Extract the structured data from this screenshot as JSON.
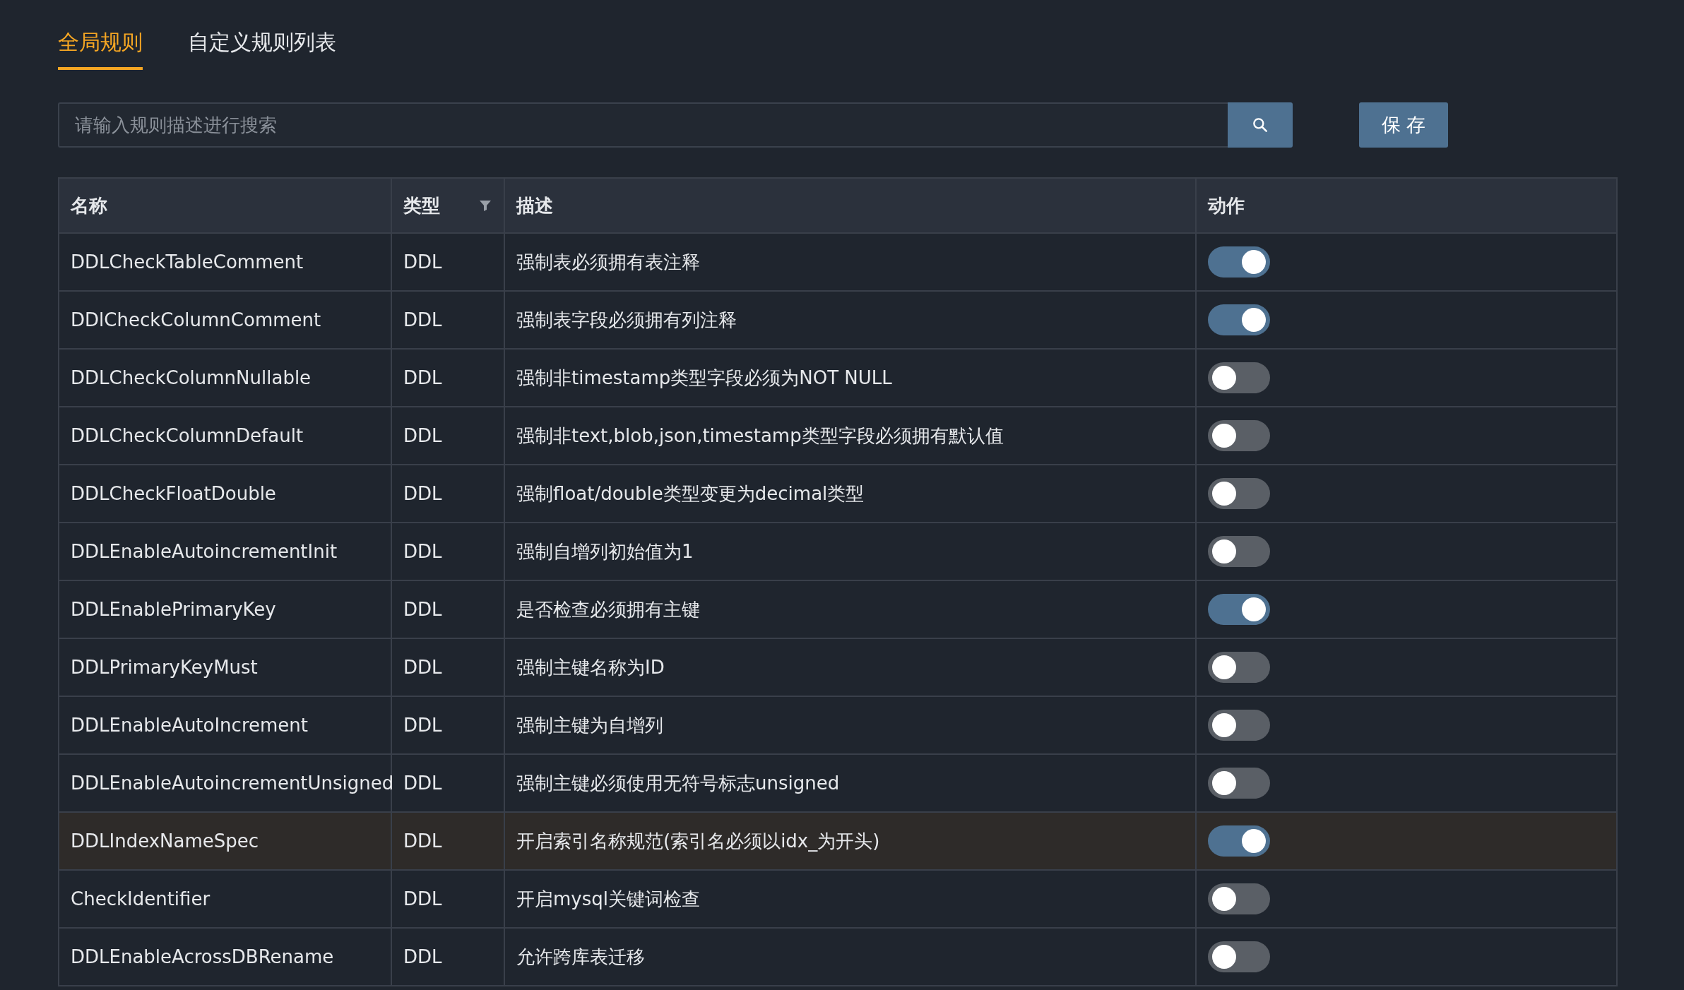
{
  "tabs": [
    {
      "label": "全局规则",
      "selected": true
    },
    {
      "label": "自定义规则列表",
      "selected": false
    }
  ],
  "search": {
    "placeholder": "请输入规则描述进行搜索"
  },
  "save_button": "保 存",
  "table": {
    "columns": [
      "名称",
      "类型",
      "描述",
      "动作"
    ],
    "rows": [
      {
        "name": "DDLCheckTableComment",
        "type": "DDL",
        "description": "强制表必须拥有表注释",
        "on": true,
        "hovered": false
      },
      {
        "name": "DDlCheckColumnComment",
        "type": "DDL",
        "description": "强制表字段必须拥有列注释",
        "on": true,
        "hovered": false
      },
      {
        "name": "DDLCheckColumnNullable",
        "type": "DDL",
        "description": "强制非timestamp类型字段必须为NOT NULL",
        "on": false,
        "hovered": false
      },
      {
        "name": "DDLCheckColumnDefault",
        "type": "DDL",
        "description": "强制非text,blob,json,timestamp类型字段必须拥有默认值",
        "on": false,
        "hovered": false
      },
      {
        "name": "DDLCheckFloatDouble",
        "type": "DDL",
        "description": "强制float/double类型变更为decimal类型",
        "on": false,
        "hovered": false
      },
      {
        "name": "DDLEnableAutoincrementInit",
        "type": "DDL",
        "description": "强制自增列初始值为1",
        "on": false,
        "hovered": false
      },
      {
        "name": "DDLEnablePrimaryKey",
        "type": "DDL",
        "description": "是否检查必须拥有主键",
        "on": true,
        "hovered": false
      },
      {
        "name": "DDLPrimaryKeyMust",
        "type": "DDL",
        "description": "强制主键名称为ID",
        "on": false,
        "hovered": false
      },
      {
        "name": "DDLEnableAutoIncrement",
        "type": "DDL",
        "description": "强制主键为自增列",
        "on": false,
        "hovered": false
      },
      {
        "name": "DDLEnableAutoincrementUnsigned",
        "type": "DDL",
        "description": "强制主键必须使用无符号标志unsigned",
        "on": false,
        "hovered": false
      },
      {
        "name": "DDLIndexNameSpec",
        "type": "DDL",
        "description": "开启索引名称规范(索引名必须以idx_为开头)",
        "on": true,
        "hovered": true
      },
      {
        "name": "CheckIdentifier",
        "type": "DDL",
        "description": "开启mysql关键词检查",
        "on": false,
        "hovered": false
      },
      {
        "name": "DDLEnableAcrossDBRename",
        "type": "DDL",
        "description": "允许跨库表迁移",
        "on": false,
        "hovered": false
      }
    ]
  }
}
